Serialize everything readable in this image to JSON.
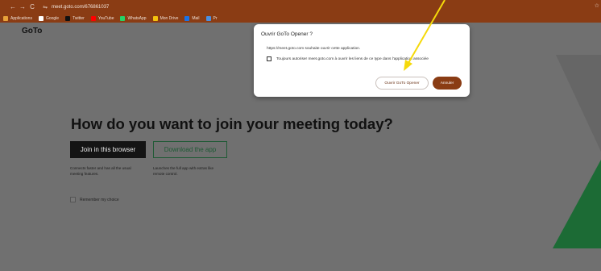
{
  "browser": {
    "back_icon": "←",
    "forward_icon": "→",
    "reload_icon": "C",
    "site_settings_icon": "⇋",
    "url": "meet.goto.com/676861037",
    "bookmark_star_icon": "☆",
    "bookmarks": [
      {
        "label": "Applications",
        "icon_color": "#e8a23a"
      },
      {
        "label": "Google",
        "icon_color": "#ffffff"
      },
      {
        "label": "Twitter",
        "icon_color": "#111111"
      },
      {
        "label": "YouTube",
        "icon_color": "#ff0000"
      },
      {
        "label": "WhatsApp",
        "icon_color": "#25d366"
      },
      {
        "label": "Mon Drive",
        "icon_color": "#f4c20d"
      },
      {
        "label": "Mail",
        "icon_color": "#1a73e8"
      },
      {
        "label": "Pr",
        "icon_color": "#4a90e2"
      }
    ]
  },
  "page": {
    "logo": "GoTo",
    "heading": "How do you want to join your meeting today?",
    "join_browser_label": "Join in this browser",
    "download_app_label": "Download the app",
    "join_desc_line1": "Connects faster and has all the usual",
    "join_desc_line2": "meeting features.",
    "download_desc_line1": "Launches the full app with extras like",
    "download_desc_line2": "remote control.",
    "remember_label": "Remember my choice"
  },
  "dialog": {
    "title": "Ouvrir GoTo Opener ?",
    "message": "https://meet.goto.com souhaite ouvrir cette application.",
    "checkbox_label": "Toujours autoriser meet.goto.com à ouvrir les liens de ce type dans l'application associée",
    "open_label": "Ouvrir GoTo Opener",
    "cancel_label": "Annuler"
  },
  "colors": {
    "browser_bar": "#8a3c14",
    "page_bg": "#707070",
    "accent_green": "#1f5a35",
    "annotation_arrow": "#f5d90a"
  }
}
